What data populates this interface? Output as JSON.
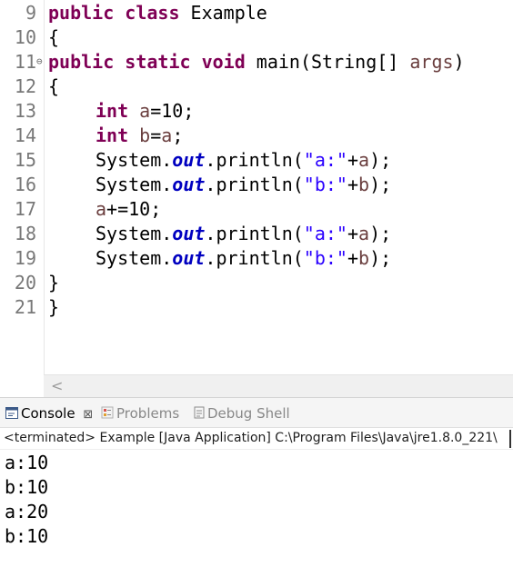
{
  "editor": {
    "lines": [
      {
        "no": "9",
        "fold": "",
        "tokens": [
          {
            "t": "public",
            "c": "kw"
          },
          {
            "t": " "
          },
          {
            "t": "class",
            "c": "kw"
          },
          {
            "t": " Example"
          }
        ]
      },
      {
        "no": "10",
        "fold": "",
        "tokens": [
          {
            "t": "{"
          }
        ]
      },
      {
        "no": "11",
        "fold": "⊖",
        "tokens": [
          {
            "t": "public",
            "c": "kw"
          },
          {
            "t": " "
          },
          {
            "t": "static",
            "c": "kw"
          },
          {
            "t": " "
          },
          {
            "t": "void",
            "c": "kw"
          },
          {
            "t": " main(String[] "
          },
          {
            "t": "args",
            "c": "var"
          },
          {
            "t": ")"
          }
        ]
      },
      {
        "no": "12",
        "fold": "",
        "tokens": [
          {
            "t": "{"
          }
        ]
      },
      {
        "no": "13",
        "fold": "",
        "indent": true,
        "tokens": [
          {
            "t": "int",
            "c": "kw"
          },
          {
            "t": " "
          },
          {
            "t": "a",
            "c": "var"
          },
          {
            "t": "=10;"
          }
        ]
      },
      {
        "no": "14",
        "fold": "",
        "indent": true,
        "tokens": [
          {
            "t": "int",
            "c": "kw"
          },
          {
            "t": " "
          },
          {
            "t": "b",
            "c": "var"
          },
          {
            "t": "="
          },
          {
            "t": "a",
            "c": "var"
          },
          {
            "t": ";"
          }
        ]
      },
      {
        "no": "15",
        "fold": "",
        "indent": true,
        "tokens": [
          {
            "t": "System."
          },
          {
            "t": "out",
            "c": "fld"
          },
          {
            "t": ".println("
          },
          {
            "t": "\"a:\"",
            "c": "str"
          },
          {
            "t": "+"
          },
          {
            "t": "a",
            "c": "var"
          },
          {
            "t": ");"
          }
        ]
      },
      {
        "no": "16",
        "fold": "",
        "indent": true,
        "tokens": [
          {
            "t": "System."
          },
          {
            "t": "out",
            "c": "fld"
          },
          {
            "t": ".println("
          },
          {
            "t": "\"b:\"",
            "c": "str"
          },
          {
            "t": "+"
          },
          {
            "t": "b",
            "c": "var"
          },
          {
            "t": ");"
          }
        ]
      },
      {
        "no": "17",
        "fold": "",
        "indent": true,
        "tokens": [
          {
            "t": "a",
            "c": "var"
          },
          {
            "t": "+=10;"
          }
        ]
      },
      {
        "no": "18",
        "fold": "",
        "indent": true,
        "tokens": [
          {
            "t": "System."
          },
          {
            "t": "out",
            "c": "fld"
          },
          {
            "t": ".println("
          },
          {
            "t": "\"a:\"",
            "c": "str"
          },
          {
            "t": "+"
          },
          {
            "t": "a",
            "c": "var"
          },
          {
            "t": ");"
          }
        ]
      },
      {
        "no": "19",
        "fold": "",
        "indent": true,
        "tokens": [
          {
            "t": "System."
          },
          {
            "t": "out",
            "c": "fld"
          },
          {
            "t": ".println("
          },
          {
            "t": "\"b:\"",
            "c": "str"
          },
          {
            "t": "+"
          },
          {
            "t": "b",
            "c": "var"
          },
          {
            "t": ");"
          }
        ]
      },
      {
        "no": "20",
        "fold": "",
        "tokens": [
          {
            "t": "}"
          }
        ]
      },
      {
        "no": "21",
        "fold": "",
        "tokens": [
          {
            "t": "}"
          }
        ]
      }
    ],
    "scroll_left_glyph": "<"
  },
  "console": {
    "tabs": [
      {
        "label": "Console",
        "close": "⊠",
        "icon": "console-icon",
        "active": true
      },
      {
        "label": "Problems",
        "icon": "problems-icon",
        "active": false
      },
      {
        "label": "Debug Shell",
        "icon": "debug-shell-icon",
        "active": false
      }
    ],
    "status": "<terminated> Example [Java Application] C:\\Program Files\\Java\\jre1.8.0_221\\",
    "output": [
      "a:10",
      "b:10",
      "a:20",
      "b:10"
    ]
  },
  "colors": {
    "keyword": "#7f0055",
    "variable": "#6a3e3e",
    "field": "#0000c0",
    "string": "#2a00ff",
    "line_number": "#787878"
  }
}
